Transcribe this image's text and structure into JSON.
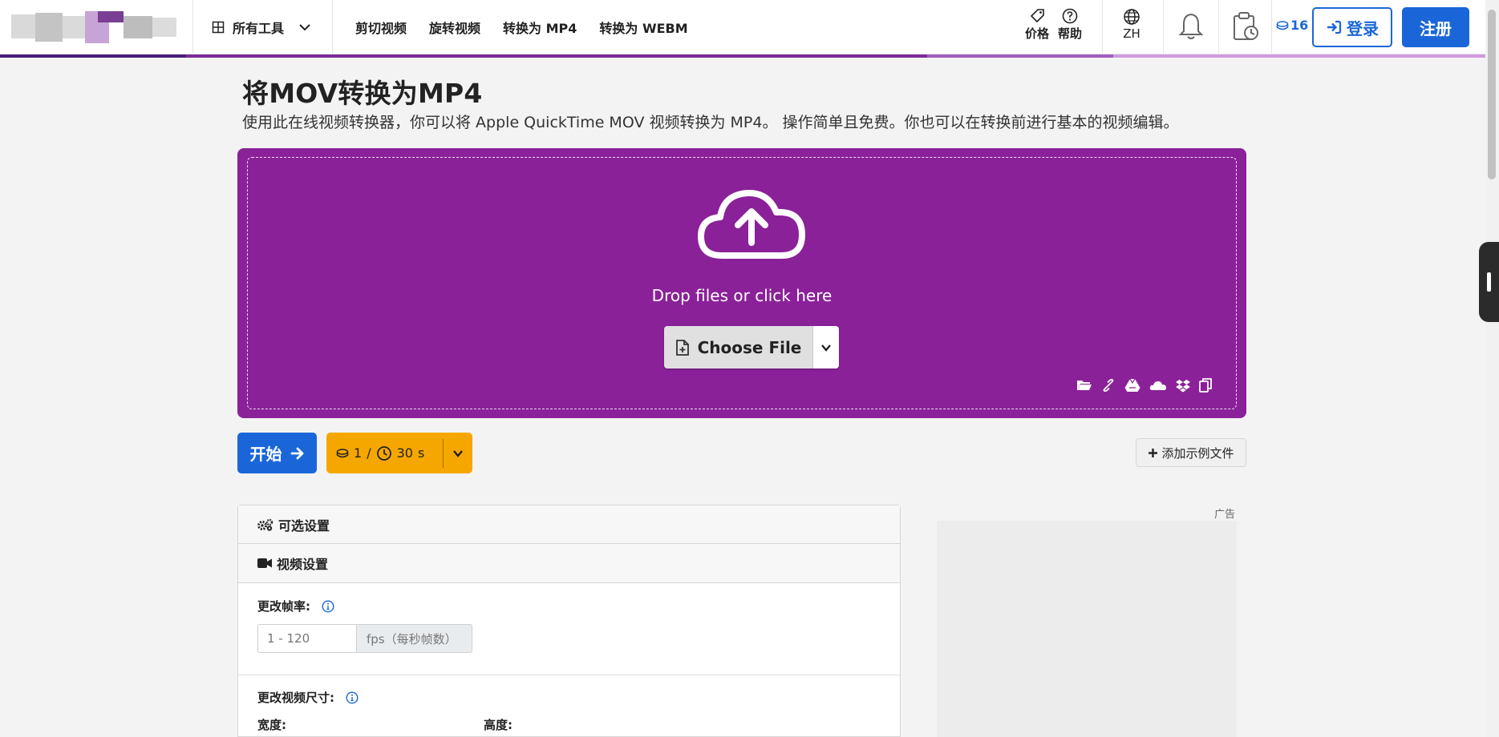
{
  "header": {
    "tools_label": "所有工具",
    "nav_links": [
      "剪切视频",
      "旋转视频",
      "转换为 MP4",
      "转换为 WEBM"
    ],
    "pricing_label": "价格",
    "help_label": "帮助",
    "language": "ZH",
    "credits": "16",
    "login_label": "登录",
    "signup_label": "注册"
  },
  "page": {
    "title": "将MOV转换为MP4",
    "description": "使用此在线视频转换器，你可以将 Apple QuickTime MOV 视频转换为 MP4。 操作简单且免费。你也可以在转换前进行基本的视频编辑。"
  },
  "upload": {
    "drop_text": "Drop files or click here",
    "choose_file": "Choose File",
    "source_icons": [
      "folder-icon",
      "link-icon",
      "google-drive-icon",
      "onedrive-icon",
      "dropbox-icon",
      "clipboard-icon"
    ]
  },
  "actions": {
    "start_label": "开始",
    "cost_credits": "1",
    "cost_separator": "/",
    "cost_time": "30",
    "cost_unit": "s",
    "add_sample_label": "添加示例文件"
  },
  "settings": {
    "optional_title": "可选设置",
    "video_title": "视频设置",
    "framerate_label": "更改帧率:",
    "framerate_placeholder": "1 - 120",
    "framerate_unit": "fps（每秒帧数）",
    "resize_label": "更改视频尺寸:",
    "width_label": "宽度:",
    "height_label": "高度:"
  },
  "ad": {
    "label": "广告"
  },
  "colors": {
    "brand_blue": "#1a66d9",
    "dropzone_purple": "#8b2199",
    "cost_orange": "#f5a700"
  }
}
